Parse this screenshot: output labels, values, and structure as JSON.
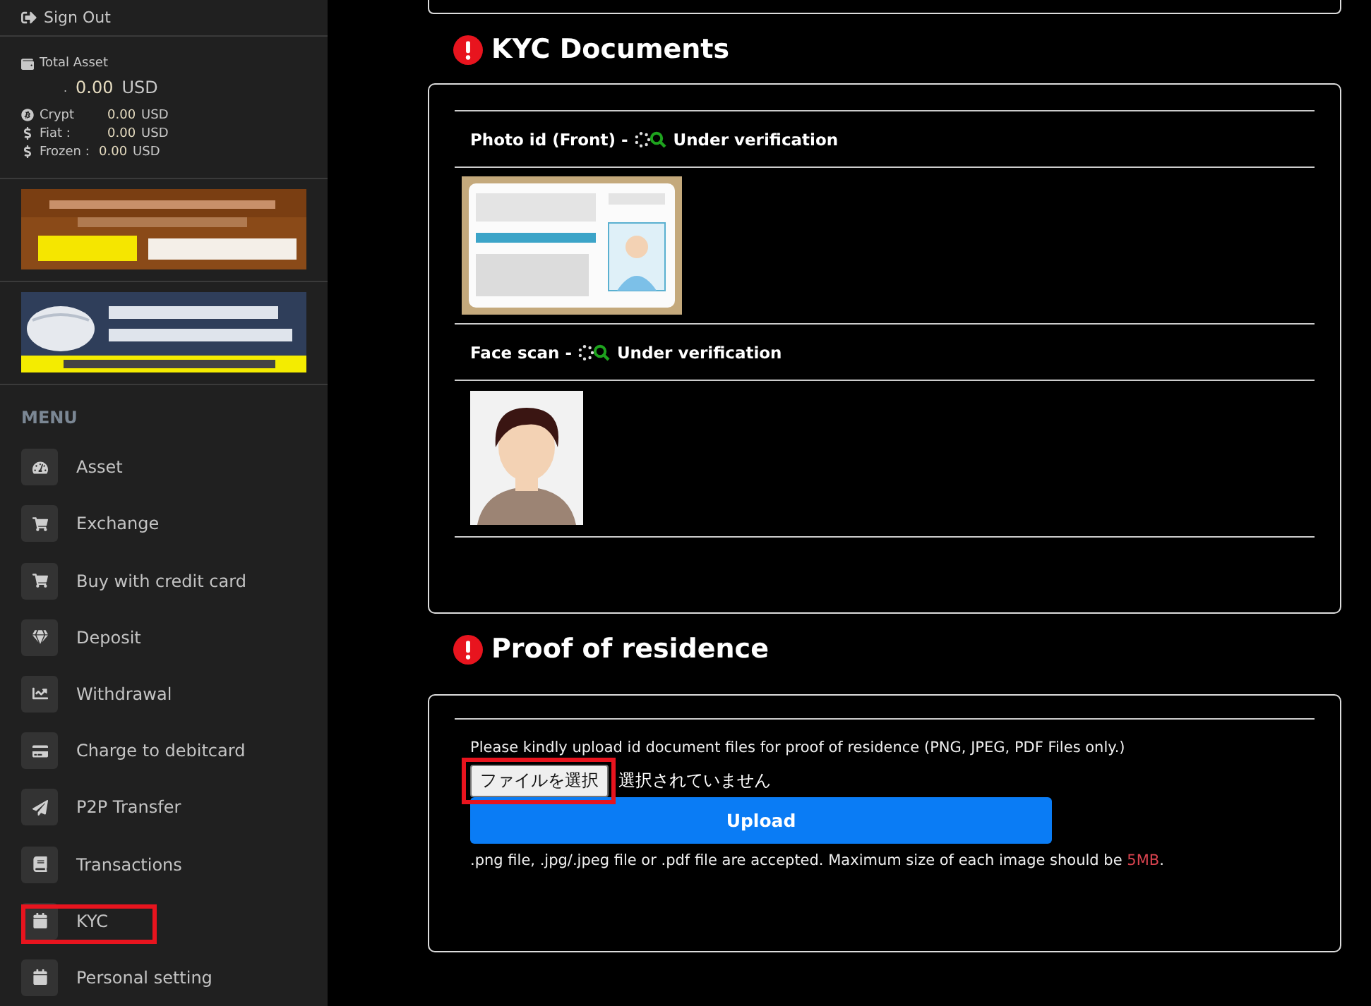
{
  "sidebar": {
    "sign_out": "Sign Out",
    "total_asset": {
      "label": "Total Asset",
      "prefix": ".",
      "amount": "0.00",
      "currency": "USD"
    },
    "balances": [
      {
        "label": "Crypt",
        "amount": "0.00",
        "currency": "USD"
      },
      {
        "label": "Fiat :",
        "amount": "0.00",
        "currency": "USD"
      },
      {
        "label": "Frozen :",
        "amount": "0.00",
        "currency": "USD"
      }
    ],
    "menu_title": "MENU",
    "menu": [
      {
        "label": "Asset",
        "highlighted": false
      },
      {
        "label": "Exchange",
        "highlighted": false
      },
      {
        "label": "Buy with credit card",
        "highlighted": false
      },
      {
        "label": "Deposit",
        "highlighted": false
      },
      {
        "label": "Withdrawal",
        "highlighted": false
      },
      {
        "label": "Charge to debitcard",
        "highlighted": false
      },
      {
        "label": "P2P Transfer",
        "highlighted": false
      },
      {
        "label": "Transactions",
        "highlighted": false
      },
      {
        "label": "KYC",
        "highlighted": true
      },
      {
        "label": "Personal setting",
        "highlighted": false
      }
    ]
  },
  "kyc": {
    "title": "KYC Documents",
    "documents": [
      {
        "name": "Photo id (Front)",
        "separator": "-",
        "status": "Under verification"
      },
      {
        "name": "Face scan",
        "separator": "-",
        "status": "Under verification"
      }
    ]
  },
  "residence": {
    "title": "Proof of residence",
    "instruction": "Please kindly upload id document files for proof of residence (PNG, JPEG, PDF Files only.)",
    "file_button": {
      "label": "ファイルを選択",
      "highlighted": true
    },
    "file_status": "選択されていません",
    "upload_button": "Upload",
    "note": ".png file, .jpg/.jpeg file or .pdf file are accepted. Maximum size of each image should be **5MB**."
  }
}
